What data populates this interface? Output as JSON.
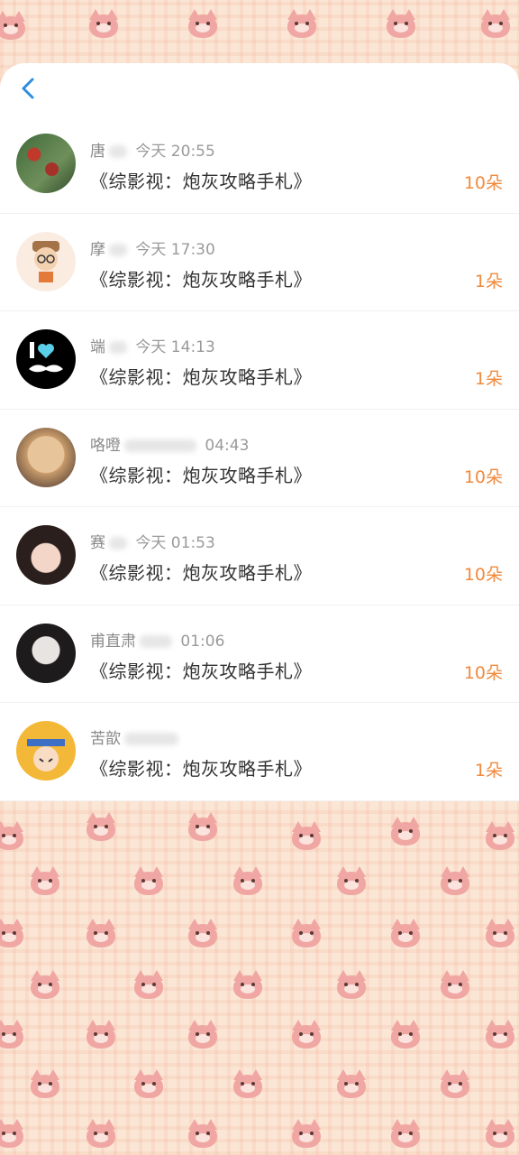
{
  "header": {
    "back_icon": "chevron-left-icon"
  },
  "items": [
    {
      "name": "唐",
      "time": "今天 20:55",
      "title": "《综影视：炮灰攻略手札》",
      "amount": "10朵",
      "avatar": "cactus-avatar"
    },
    {
      "name": "摩",
      "time": "今天 17:30",
      "title": "《综影视：炮灰攻略手札》",
      "amount": "1朵",
      "avatar": "cartoon-boy-avatar"
    },
    {
      "name": "端",
      "time": "今天 14:13",
      "title": "《综影视：炮灰攻略手札》",
      "amount": "1朵",
      "avatar": "i-love-mustache-avatar"
    },
    {
      "name": "咯噔",
      "time": "04:43",
      "title": "《综影视：炮灰攻略手札》",
      "amount": "10朵",
      "avatar": "cat-photo-avatar"
    },
    {
      "name": "赛",
      "time": "今天 01:53",
      "title": "《综影视：炮灰攻略手札》",
      "amount": "10朵",
      "avatar": "girl-photo-avatar"
    },
    {
      "name": "甫直肃",
      "time": "01:06",
      "title": "《综影视：炮灰攻略手札》",
      "amount": "10朵",
      "avatar": "girl-bw-avatar"
    },
    {
      "name": "苦歆",
      "time": "",
      "title": "《综影视：炮灰攻略手札》",
      "amount": "1朵",
      "avatar": "naruto-avatar"
    }
  ],
  "colors": {
    "accent": "#f08a3e",
    "back": "#2f8de0"
  }
}
